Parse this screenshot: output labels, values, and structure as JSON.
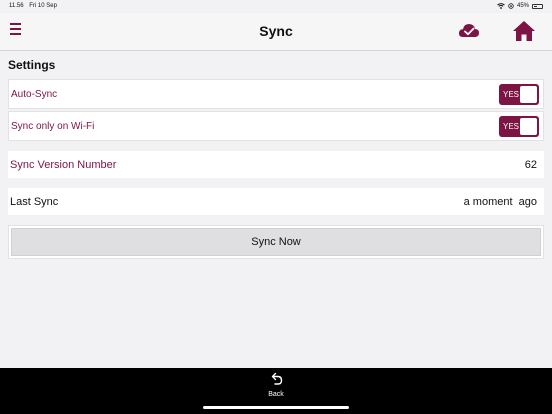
{
  "status_bar": {
    "time": "11.56",
    "date": "Fri 10 Sep",
    "battery": "45%"
  },
  "header": {
    "title": "Sync"
  },
  "settings": {
    "section_title": "Settings",
    "auto_sync": {
      "label": "Auto-Sync",
      "toggle": "YES",
      "enabled": true
    },
    "wifi_only": {
      "label": "Sync only on Wi-Fi",
      "toggle": "YES",
      "enabled": true
    }
  },
  "info": {
    "version": {
      "label": "Sync Version Number",
      "value": "62"
    },
    "last_sync": {
      "label": "Last Sync",
      "value": "a moment  ago"
    }
  },
  "actions": {
    "sync_now": "Sync Now"
  },
  "bottom": {
    "back_label": "Back"
  },
  "colors": {
    "accent": "#7d1544",
    "background": "#f2f2f4",
    "bottom_bar": "#000000"
  }
}
